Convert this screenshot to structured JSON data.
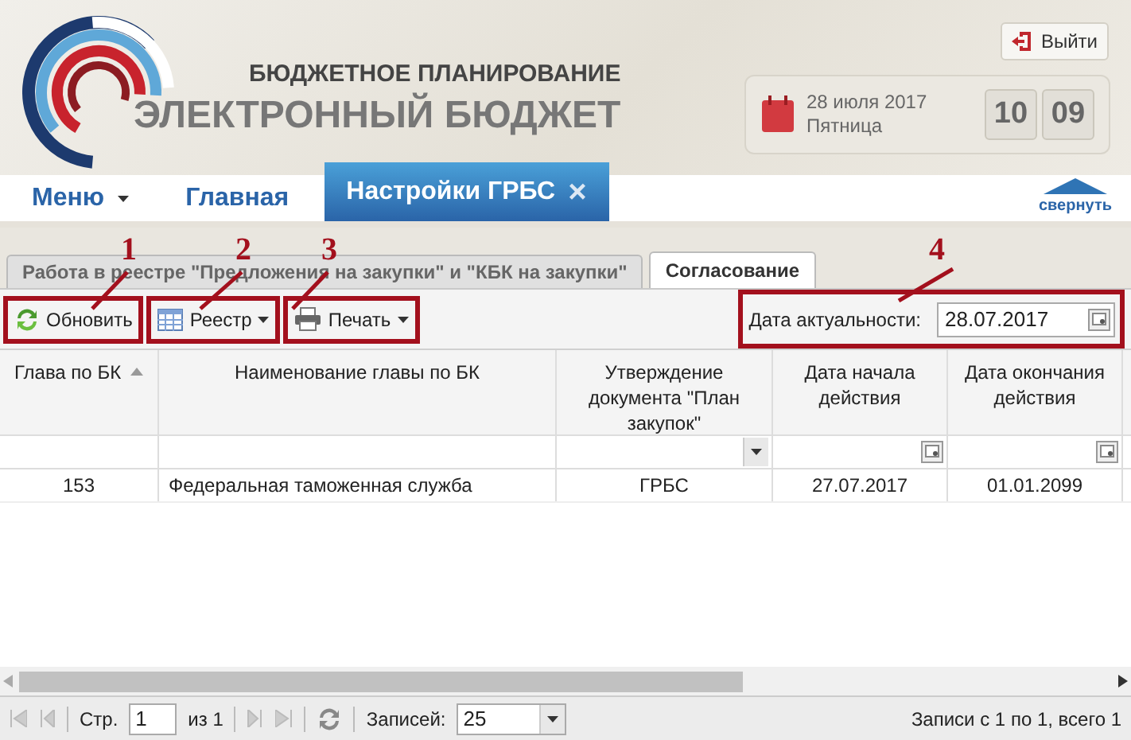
{
  "header": {
    "title_top": "БЮДЖЕТНОЕ ПЛАНИРОВАНИЕ",
    "title_main": "ЭЛЕКТРОННЫЙ БЮДЖЕТ",
    "exit": "Выйти",
    "date": "28 июля 2017",
    "weekday": "Пятница",
    "hours": "10",
    "minutes": "09"
  },
  "nav": {
    "menu": "Меню",
    "items": [
      {
        "label": "Главная",
        "selected": false
      },
      {
        "label": "Настройки ГРБС",
        "selected": true,
        "close": "×"
      }
    ],
    "collapse": "свернуть"
  },
  "tabs": [
    {
      "label": "Работа в реестре \"Предложения на закупки\" и \"КБК на закупки\"",
      "selected": false
    },
    {
      "label": "Согласование",
      "selected": true
    }
  ],
  "toolbar": {
    "buttons": [
      {
        "label": "Обновить",
        "kind": "refresh",
        "dropdown": false
      },
      {
        "label": "Реестр",
        "kind": "registry",
        "dropdown": true
      },
      {
        "label": "Печать",
        "kind": "print",
        "dropdown": true
      }
    ],
    "date_label": "Дата актуальности:",
    "date_value": "28.07.2017"
  },
  "annotations": [
    "1",
    "2",
    "3",
    "4"
  ],
  "table": {
    "columns": [
      {
        "label": "Глава по БК",
        "sorted": true
      },
      {
        "label": "Наименование главы по БК",
        "sorted": false
      },
      {
        "label": "Утверждение документа \"План закупок\"",
        "sorted": false
      },
      {
        "label": "Дата начала действия",
        "sorted": false
      },
      {
        "label": "Дата окончания действия",
        "sorted": false
      }
    ],
    "filters": [
      {
        "kind": "text"
      },
      {
        "kind": "text"
      },
      {
        "kind": "select"
      },
      {
        "kind": "date"
      },
      {
        "kind": "date"
      }
    ],
    "rows": [
      [
        "153",
        "Федеральная таможенная служба",
        "ГРБС",
        "27.07.2017",
        "01.01.2099"
      ]
    ]
  },
  "pager": {
    "page_label": "Стр.",
    "page": "1",
    "of": "из 1",
    "records_label": "Записей:",
    "per_page": "25",
    "summary": "Записи с 1 по 1, всего 1"
  }
}
